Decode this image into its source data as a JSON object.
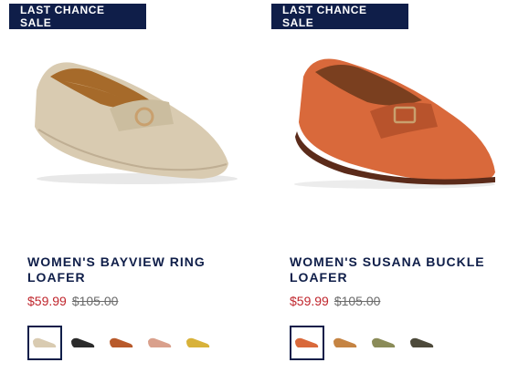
{
  "products": [
    {
      "badge": "LAST CHANCE SALE",
      "title": "WOMEN'S BAYVIEW RING LOAFER",
      "sale_price": "$59.99",
      "original_price": "$105.00",
      "colors": {
        "shoe": "#d9cbb1",
        "shadow": "#bfae93",
        "trim": "#c9a06e"
      },
      "swatches": [
        {
          "name": "beige",
          "color": "#d9cbb1",
          "selected": true
        },
        {
          "name": "black",
          "color": "#2b2b2b",
          "selected": false
        },
        {
          "name": "cognac",
          "color": "#b85a2b",
          "selected": false
        },
        {
          "name": "blush",
          "color": "#d9a08c",
          "selected": false
        },
        {
          "name": "yellow",
          "color": "#d8b23a",
          "selected": false
        }
      ]
    },
    {
      "badge": "LAST CHANCE SALE",
      "title": "WOMEN'S SUSANA BUCKLE LOAFER",
      "sale_price": "$59.99",
      "original_price": "$105.00",
      "colors": {
        "shoe": "#d9693b",
        "shadow": "#b8532c",
        "trim": "#5b2b1a"
      },
      "swatches": [
        {
          "name": "orange",
          "color": "#d9693b",
          "selected": true
        },
        {
          "name": "tan",
          "color": "#c58443",
          "selected": false
        },
        {
          "name": "olive",
          "color": "#8a8b58",
          "selected": false
        },
        {
          "name": "dark-olive",
          "color": "#4d4a3b",
          "selected": false
        }
      ]
    }
  ]
}
